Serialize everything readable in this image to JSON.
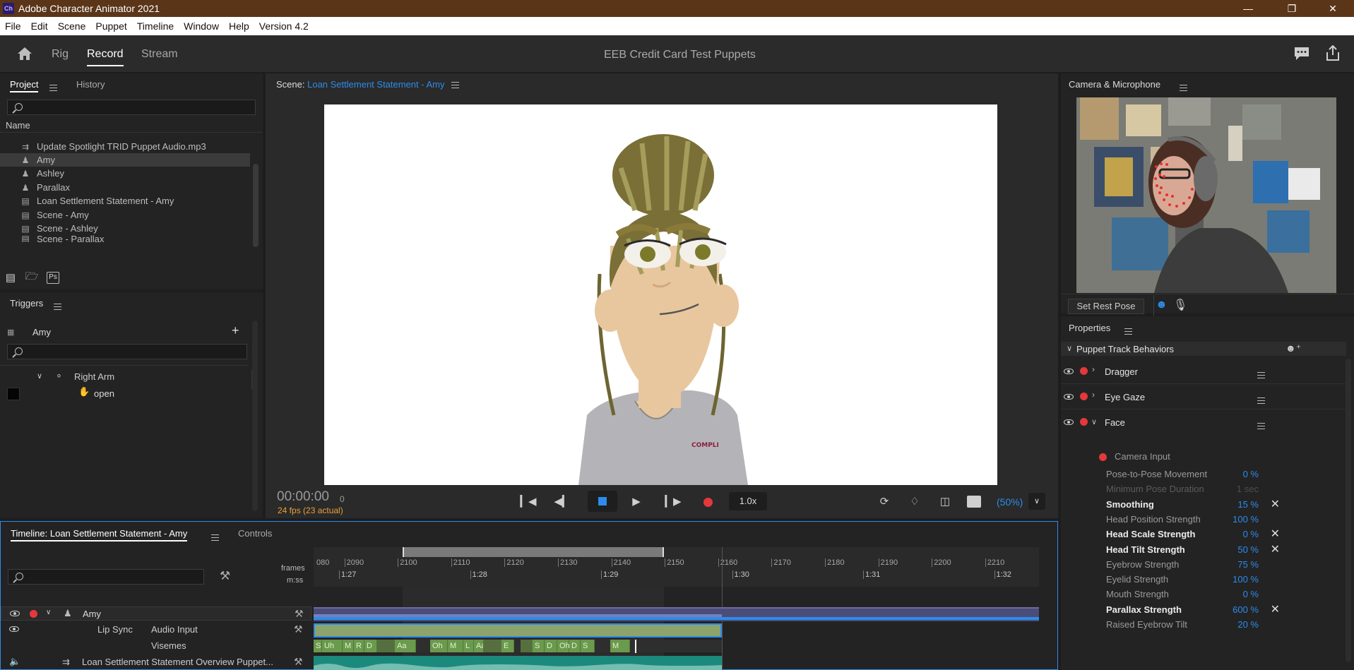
{
  "window": {
    "title": "Adobe Character Animator 2021",
    "app_badge": "Ch"
  },
  "menu": [
    "File",
    "Edit",
    "Scene",
    "Puppet",
    "Timeline",
    "Window",
    "Help",
    "Version 4.2"
  ],
  "workspace": {
    "tabs": [
      "Rig",
      "Record",
      "Stream"
    ],
    "active_tab": "Record",
    "project_name": "EEB Credit Card Test Puppets"
  },
  "project_panel": {
    "tabs": [
      "Project",
      "History"
    ],
    "column_name": "Name",
    "items": [
      {
        "label": "Update Spotlight TRID Puppet Audio.mp3",
        "icon": "audio-icon"
      },
      {
        "label": "Amy",
        "icon": "puppet-icon",
        "selected": true
      },
      {
        "label": "Ashley",
        "icon": "puppet-icon"
      },
      {
        "label": "Parallax",
        "icon": "puppet-icon"
      },
      {
        "label": "Loan Settlement Statement  - Amy",
        "icon": "scene-icon"
      },
      {
        "label": "Scene - Amy",
        "icon": "scene-icon"
      },
      {
        "label": "Scene - Ashley",
        "icon": "scene-icon"
      },
      {
        "label": "Scene - Parallax",
        "icon": "scene-icon"
      }
    ],
    "footer_ps": "Ps"
  },
  "triggers_panel": {
    "title": "Triggers",
    "puppet": "Amy",
    "tree": [
      {
        "label": "Right Arm",
        "icon": "layer-group-icon"
      },
      {
        "label": "open",
        "icon": "hand-trigger-icon"
      }
    ]
  },
  "scene_panel": {
    "prefix": "Scene:",
    "name": "Loan Settlement Statement  - Amy",
    "timecode": "00:00:00",
    "frame": "0",
    "fps": "24 fps (23 actual)",
    "speed": "1.0x",
    "zoom": "(50%)"
  },
  "camera_panel": {
    "title": "Camera & Microphone",
    "set_rest_pose": "Set Rest Pose"
  },
  "properties_panel": {
    "title": "Properties",
    "section": "Puppet Track Behaviors",
    "behaviors": [
      "Dragger",
      "Eye Gaze",
      "Face"
    ],
    "face_camera_input": "Camera Input",
    "params": [
      {
        "label": "Pose-to-Pose Movement",
        "value": "0 %",
        "bold": false,
        "dim": false,
        "x": false
      },
      {
        "label": "Minimum Pose Duration",
        "value": "1 sec",
        "bold": false,
        "dim": true,
        "x": false
      },
      {
        "label": "Smoothing",
        "value": "15 %",
        "bold": true,
        "dim": false,
        "x": true
      },
      {
        "label": "Head Position Strength",
        "value": "100 %",
        "bold": false,
        "dim": false,
        "x": false
      },
      {
        "label": "Head Scale Strength",
        "value": "0 %",
        "bold": true,
        "dim": false,
        "x": true
      },
      {
        "label": "Head Tilt Strength",
        "value": "50 %",
        "bold": true,
        "dim": false,
        "x": true
      },
      {
        "label": "Eyebrow Strength",
        "value": "75 %",
        "bold": false,
        "dim": false,
        "x": false
      },
      {
        "label": "Eyelid Strength",
        "value": "100 %",
        "bold": false,
        "dim": false,
        "x": false
      },
      {
        "label": "Mouth Strength",
        "value": "0 %",
        "bold": false,
        "dim": false,
        "x": false
      },
      {
        "label": "Parallax Strength",
        "value": "600 %",
        "bold": true,
        "dim": false,
        "x": true
      },
      {
        "label": "Raised Eyebrow Tilt",
        "value": "20 %",
        "bold": false,
        "dim": false,
        "x": false
      }
    ]
  },
  "timeline_panel": {
    "title": "Timeline: Loan Settlement Statement  - Amy",
    "controls_tab": "Controls",
    "frames_label": "frames",
    "mmss_label": "m:ss",
    "frame_ticks": [
      "080",
      "2090",
      "2100",
      "2110",
      "2120",
      "2130",
      "2140",
      "2150",
      "2160",
      "2170",
      "2180",
      "2190",
      "2200",
      "2210"
    ],
    "time_ticks": [
      "1:27",
      "1:28",
      "1:29",
      "1:30",
      "1:31",
      "1:32"
    ],
    "tracks": {
      "puppet": "Amy",
      "lip_sync": "Lip Sync",
      "audio_input": "Audio Input",
      "visemes": "Visemes",
      "audio_file": "Loan Settlement Statement Overview Puppet..."
    },
    "visemes": [
      "S",
      "Uh",
      "M",
      "R",
      "D",
      "Aa",
      "Oh",
      "M",
      "L",
      "Aa",
      "E",
      "S",
      "D",
      "Oh",
      "D",
      "S",
      "M"
    ]
  },
  "colors": {
    "accent_blue": "#2d8ceb",
    "record_red": "#e5383b",
    "fps_orange": "#e8a23a",
    "title_brown": "#5a3518"
  }
}
